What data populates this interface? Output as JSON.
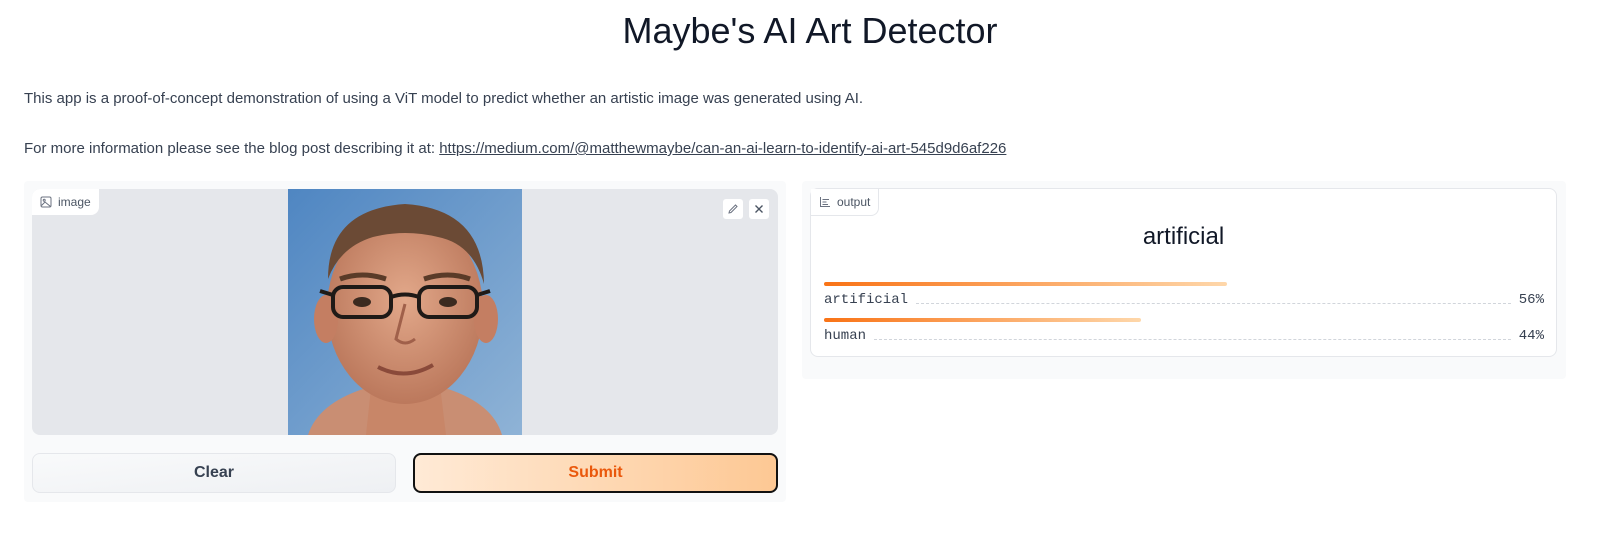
{
  "header": {
    "title": "Maybe's AI Art Detector",
    "description": "This app is a proof-of-concept demonstration of using a ViT model to predict whether an artistic image was generated using AI.",
    "more_info_prefix": "For more information please see the blog post describing it at: ",
    "blog_link": "https://medium.com/@matthewmaybe/can-an-ai-learn-to-identify-ai-art-545d9d6af226"
  },
  "input": {
    "label": "image",
    "icon": "image-icon",
    "tools": [
      "pencil-icon",
      "close-icon"
    ]
  },
  "buttons": {
    "clear": "Clear",
    "submit": "Submit"
  },
  "output": {
    "label": "output",
    "icon": "bar-chart-icon",
    "top_label": "artificial",
    "confidences": [
      {
        "label": "artificial",
        "percent": "56%",
        "value": 0.56
      },
      {
        "label": "human",
        "percent": "44%",
        "value": 0.44
      }
    ]
  },
  "colors": {
    "accent": "#f97316",
    "submit_text": "#ea580c",
    "panel_bg": "#f9fafb",
    "image_bg": "#e5e7eb"
  }
}
